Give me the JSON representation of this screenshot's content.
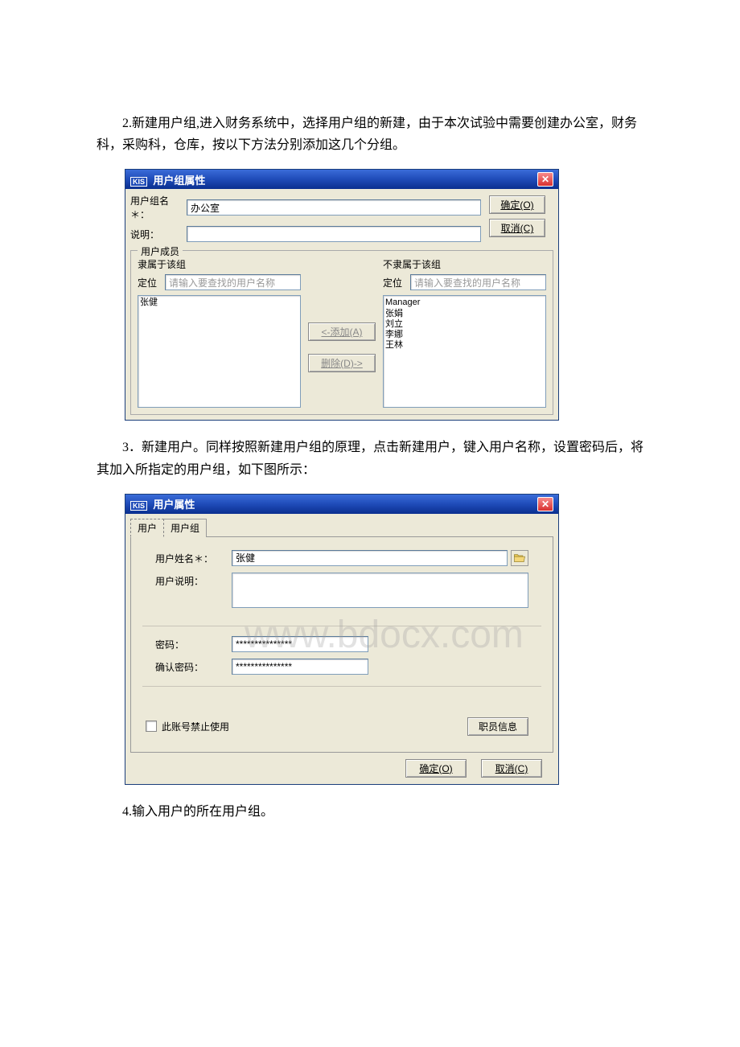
{
  "paragraphs": {
    "p1": "2.新建用户组,进入财务系统中，选择用户组的新建，由于本次试验中需要创建办公室，财务科，采购科，仓库，按以下方法分别添加这几个分组。",
    "p2": "3．新建用户。同样按照新建用户组的原理，点击新建用户，键入用户名称，设置密码后，将其加入所指定的用户组，如下图所示：",
    "p3": "4.输入用户的所在用户组。"
  },
  "dialog1": {
    "title_prefix": "KIS",
    "title": "用户组属性",
    "group_name_label": "用户组名＊：",
    "group_name_value": "办公室",
    "desc_label": "说明：",
    "desc_value": "",
    "ok_btn": "确定(O)",
    "cancel_btn": "取消(C)",
    "members_legend": "用户成员",
    "belong_label": "隶属于该组",
    "notbelong_label": "不隶属于该组",
    "locate_label_left": "定位",
    "locate_label_right": "定位",
    "locate_placeholder_left": "请输入要查找的用户名称",
    "locate_placeholder_right": "请输入要查找的用户名称",
    "add_btn": "<-添加(A)",
    "del_btn": "删除(D)->",
    "left_list": [
      "张健"
    ],
    "right_list": [
      "Manager",
      "张娟",
      "刘立",
      "李娜",
      "王林"
    ]
  },
  "dialog2": {
    "title_prefix": "KIS",
    "title": "用户属性",
    "tab_user": "用户",
    "tab_group": "用户组",
    "username_label": "用户姓名＊：",
    "username_value": "张健",
    "userdesc_label": "用户说明：",
    "userdesc_value": "",
    "password_label": "密码：",
    "password_value": "***************",
    "confirm_label": "确认密码：",
    "confirm_value": "***************",
    "disable_label": "此账号禁止使用",
    "employee_btn": "职员信息",
    "ok_btn": "确定(O)",
    "cancel_btn": "取消(C)"
  },
  "watermark": "www.bdocx.com"
}
